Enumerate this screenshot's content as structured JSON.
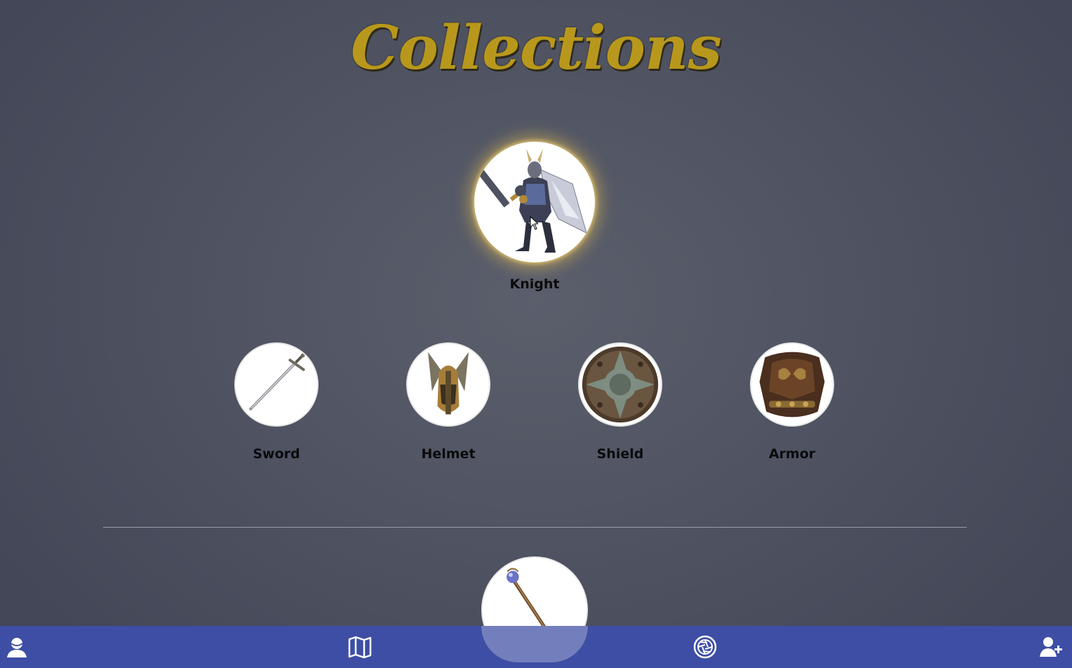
{
  "page": {
    "title": "Collections"
  },
  "featured": {
    "name": "Knight",
    "image_icon": "knight-figure-icon"
  },
  "items": [
    {
      "name": "Sword",
      "image_icon": "sword-icon"
    },
    {
      "name": "Helmet",
      "image_icon": "winged-helmet-icon"
    },
    {
      "name": "Shield",
      "image_icon": "round-shield-icon"
    },
    {
      "name": "Armor",
      "image_icon": "breastplate-armor-icon"
    }
  ],
  "next_item": {
    "image_icon": "magic-staff-icon"
  },
  "navbar": {
    "background": "#3d4ea4",
    "buttons": [
      {
        "icon": "profile-icon"
      },
      {
        "icon": "map-icon"
      },
      {
        "icon": "camera-shutter-icon"
      },
      {
        "icon": "add-user-icon"
      }
    ]
  },
  "colors": {
    "title_gold": "#b8981c",
    "background": "#525664",
    "glow": "#e6be50"
  }
}
